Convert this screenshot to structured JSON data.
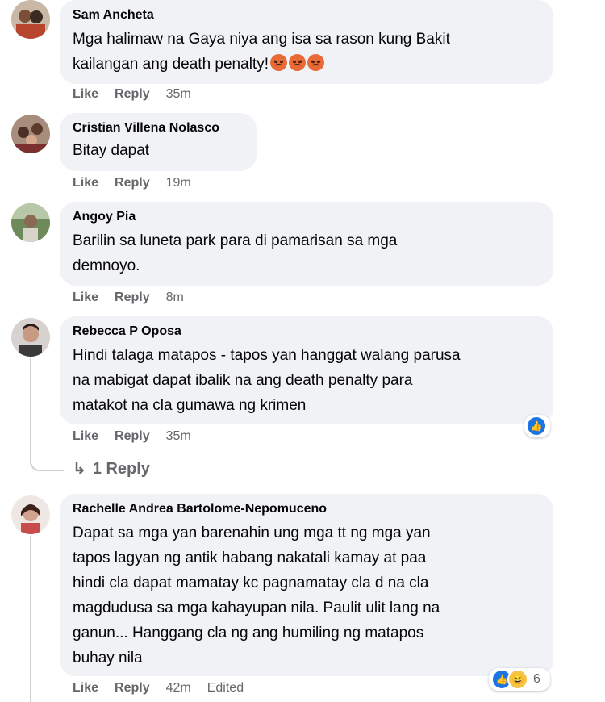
{
  "comments": [
    {
      "author": "Sam Ancheta",
      "lines": [
        "Mga halimaw na Gaya niya ang isa sa rason kung Bakit",
        "kailangan ang death penalty!"
      ],
      "emoji": [
        "angry-face",
        "angry-face",
        "angry-face"
      ],
      "like": "Like",
      "reply": "Reply",
      "time": "35m"
    },
    {
      "author": "Cristian Villena Nolasco",
      "lines": [
        "Bitay dapat"
      ],
      "like": "Like",
      "reply": "Reply",
      "time": "19m"
    },
    {
      "author": "Angoy Pia",
      "lines": [
        "Barilin sa luneta park para di pamarisan sa mga",
        "demnoyo."
      ],
      "like": "Like",
      "reply": "Reply",
      "time": "8m"
    },
    {
      "author": "Rebecca P Oposa",
      "lines": [
        "Hindi talaga matapos - tapos yan hanggat walang parusa",
        "na mabigat dapat ibalik na ang death penalty para",
        "matakot na cla gumawa ng krimen"
      ],
      "reactions": [
        "like"
      ],
      "like": "Like",
      "reply": "Reply",
      "time": "35m",
      "replies_link": "1 Reply"
    },
    {
      "author": "Rachelle Andrea Bartolome-Nepomuceno",
      "lines": [
        "Dapat sa mga yan barenahin ung mga tt ng mga yan",
        "tapos lagyan ng antik habang nakatali kamay at paa",
        "hindi cla dapat mamatay kc pagnamatay cla d na cla",
        "magdudusa sa mga kahayupan nila. Paulit ulit lang na",
        "ganun... Hanggang cla ng ang humiling ng matapos",
        "buhay nila"
      ],
      "reactions": [
        "like",
        "haha"
      ],
      "reaction_count": "6",
      "like": "Like",
      "reply": "Reply",
      "time": "42m",
      "edited": "Edited"
    }
  ],
  "colors": {
    "bubble": "#f0f2f5",
    "meta": "#65676b",
    "like_blue": "#1b74e4"
  }
}
